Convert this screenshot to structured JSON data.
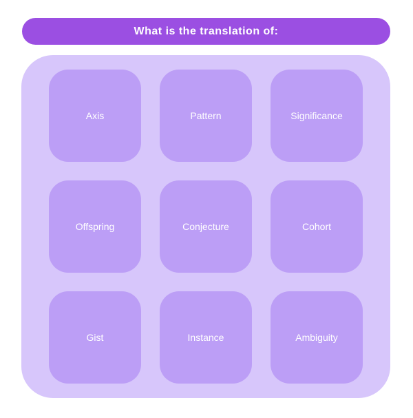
{
  "header": {
    "title": "What is the translation of:"
  },
  "options": [
    {
      "label": "Axis"
    },
    {
      "label": "Pattern"
    },
    {
      "label": "Significance"
    },
    {
      "label": "Offspring"
    },
    {
      "label": "Conjecture"
    },
    {
      "label": "Cohort"
    },
    {
      "label": "Gist"
    },
    {
      "label": "Instance"
    },
    {
      "label": "Ambiguity"
    }
  ],
  "colors": {
    "header_bg": "#9b4fe2",
    "panel_bg": "#d7c6fb",
    "tile_bg": "#bc9ef6",
    "text": "#ffffff"
  }
}
